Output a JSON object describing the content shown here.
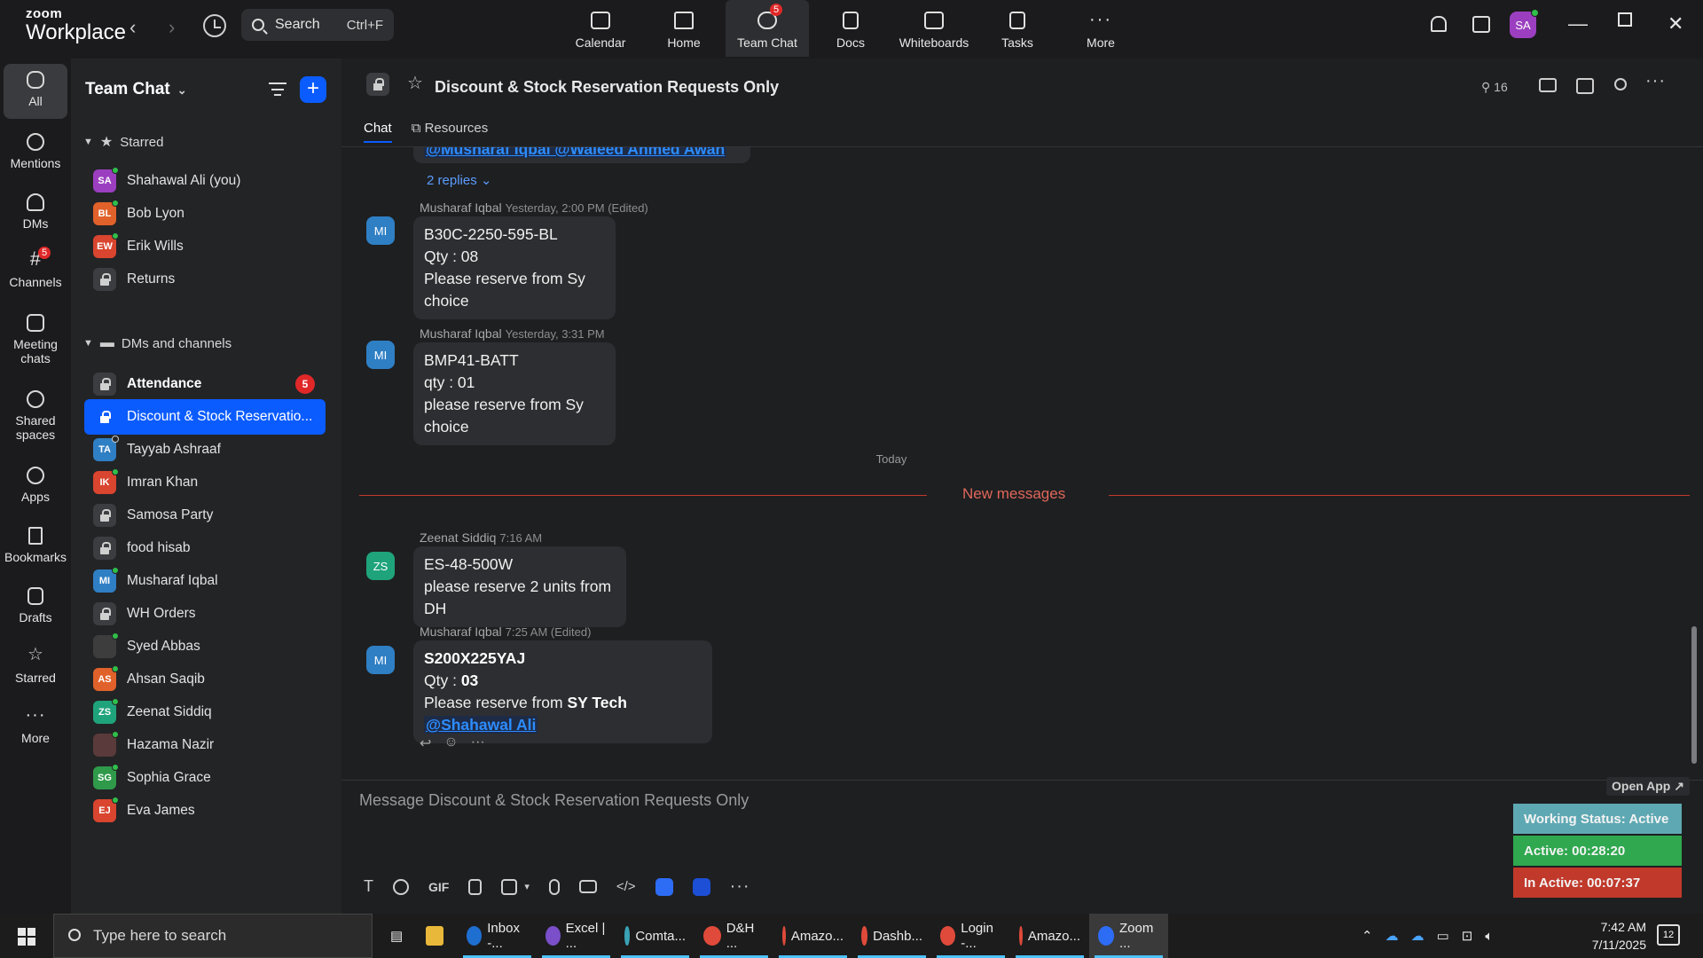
{
  "topbar": {
    "logo_line1": "zoom",
    "logo_line2": "Workplace",
    "search_label": "Search",
    "search_shortcut": "Ctrl+F",
    "tabs": [
      {
        "label": "Calendar"
      },
      {
        "label": "Home"
      },
      {
        "label": "Team Chat",
        "badge": "5"
      },
      {
        "label": "Docs"
      },
      {
        "label": "Whiteboards"
      },
      {
        "label": "Tasks"
      },
      {
        "label": "More"
      }
    ],
    "user_initials": "SA"
  },
  "rail": {
    "items": [
      {
        "label": "All"
      },
      {
        "label": "Mentions"
      },
      {
        "label": "DMs"
      },
      {
        "label": "Channels",
        "badge": "5"
      },
      {
        "label": "Meeting chats"
      },
      {
        "label": "Shared spaces"
      },
      {
        "label": "Apps"
      },
      {
        "label": "Bookmarks"
      },
      {
        "label": "Drafts"
      },
      {
        "label": "Starred"
      },
      {
        "label": "More"
      }
    ]
  },
  "sidebar": {
    "title": "Team Chat",
    "starred_label": "Starred",
    "dms_label": "DMs and channels",
    "starred": [
      {
        "name": "Shahawal Ali (you)",
        "initials": "SA",
        "color": "#9b3fc0",
        "status": "on"
      },
      {
        "name": "Bob Lyon",
        "initials": "BL",
        "color": "#e0622a",
        "status": "on"
      },
      {
        "name": "Erik Wills",
        "initials": "EW",
        "color": "#d9452f",
        "status": "on"
      },
      {
        "name": "Returns",
        "type": "channel"
      }
    ],
    "channels": [
      {
        "name": "Attendance",
        "type": "channel",
        "badge": "5",
        "bold": true
      },
      {
        "name": "Discount & Stock Reservatio...",
        "type": "channel",
        "selected": true
      },
      {
        "name": "Tayyab Ashraaf",
        "initials": "TA",
        "color": "#2f7fc4",
        "status": "off"
      },
      {
        "name": "Imran Khan",
        "initials": "IK",
        "color": "#d9452f",
        "status": "on"
      },
      {
        "name": "Samosa Party",
        "type": "channel"
      },
      {
        "name": "food hisab",
        "type": "channel"
      },
      {
        "name": "Musharaf Iqbal",
        "initials": "MI",
        "color": "#2f7fc4",
        "status": "on"
      },
      {
        "name": "WH Orders",
        "type": "channel"
      },
      {
        "name": "Syed Abbas",
        "initials": "",
        "color": "#3d3d3d",
        "status": "on"
      },
      {
        "name": "Ahsan Saqib",
        "initials": "AS",
        "color": "#e0622a",
        "status": "on"
      },
      {
        "name": "Zeenat Siddiq",
        "initials": "ZS",
        "color": "#1fa37a",
        "status": "on"
      },
      {
        "name": "Hazama Nazir",
        "initials": "",
        "color": "#5a3a3a",
        "status": "on"
      },
      {
        "name": "Sophia Grace",
        "initials": "SG",
        "color": "#2f9a4a",
        "status": "on"
      },
      {
        "name": "Eva James",
        "initials": "EJ",
        "color": "#d9452f",
        "status": "on"
      }
    ]
  },
  "channel": {
    "title": "Discount & Stock Reservation Requests Only",
    "members": "16",
    "tab_chat": "Chat",
    "tab_resources": "Resources"
  },
  "feed": {
    "partial_mentions": "@Musharaf Iqbal @Waleed Ahmed Awan",
    "replies": "2 replies",
    "messages": [
      {
        "initials": "MI",
        "author": "Musharaf Iqbal",
        "time": "Yesterday, 2:00 PM (Edited)",
        "lines": [
          "B30C-2250-595-BL",
          "Qty : 08",
          "Please reserve from Sy choice"
        ]
      },
      {
        "initials": "MI",
        "author": "Musharaf Iqbal",
        "time": "Yesterday, 3:31 PM",
        "lines": [
          "BMP41-BATT",
          "qty : 01",
          "please reserve from Sy choice"
        ]
      },
      {
        "initials": "ZS",
        "author": "Zeenat Siddiq",
        "time": "7:16 AM",
        "lines": [
          "ES-48-500W",
          "please reserve 2 units from DH"
        ]
      },
      {
        "initials": "MI",
        "author": "Musharaf Iqbal",
        "time": "7:25 AM (Edited)",
        "line1": "S200X225YAJ",
        "line2_label": "Qty : ",
        "line2_value": "03",
        "line3_label": "Please reserve from ",
        "line3_bold": "SY Tech",
        "mention": "@Shahawal Ali"
      }
    ],
    "today": "Today",
    "new_messages": "New messages"
  },
  "composer": {
    "placeholder": "Message Discount & Stock Reservation Requests Only",
    "gif": "GIF"
  },
  "widget": {
    "open_app": "Open App ↗",
    "working_status": "Working Status: Active",
    "active": "Active: 00:28:20",
    "inactive": "In Active: 00:07:37"
  },
  "taskbar": {
    "search_placeholder": "Type here to search",
    "apps": [
      {
        "label": "Inbox -...",
        "color": "#1f6fd1"
      },
      {
        "label": "Excel | ...",
        "color": "#7a4fc9"
      },
      {
        "label": "Comta...",
        "color": "#3aa3b5"
      },
      {
        "label": "D&H ...",
        "color": "#e04a3a"
      },
      {
        "label": "Amazo...",
        "color": "#e04a3a"
      },
      {
        "label": "Dashb...",
        "color": "#e04a3a"
      },
      {
        "label": "Login -...",
        "color": "#e04a3a"
      },
      {
        "label": "Amazo...",
        "color": "#e04a3a"
      },
      {
        "label": "Zoom ...",
        "color": "#2d6cf5"
      }
    ],
    "time": "7:42 AM",
    "date": "7/11/2025",
    "notifications": "12"
  }
}
